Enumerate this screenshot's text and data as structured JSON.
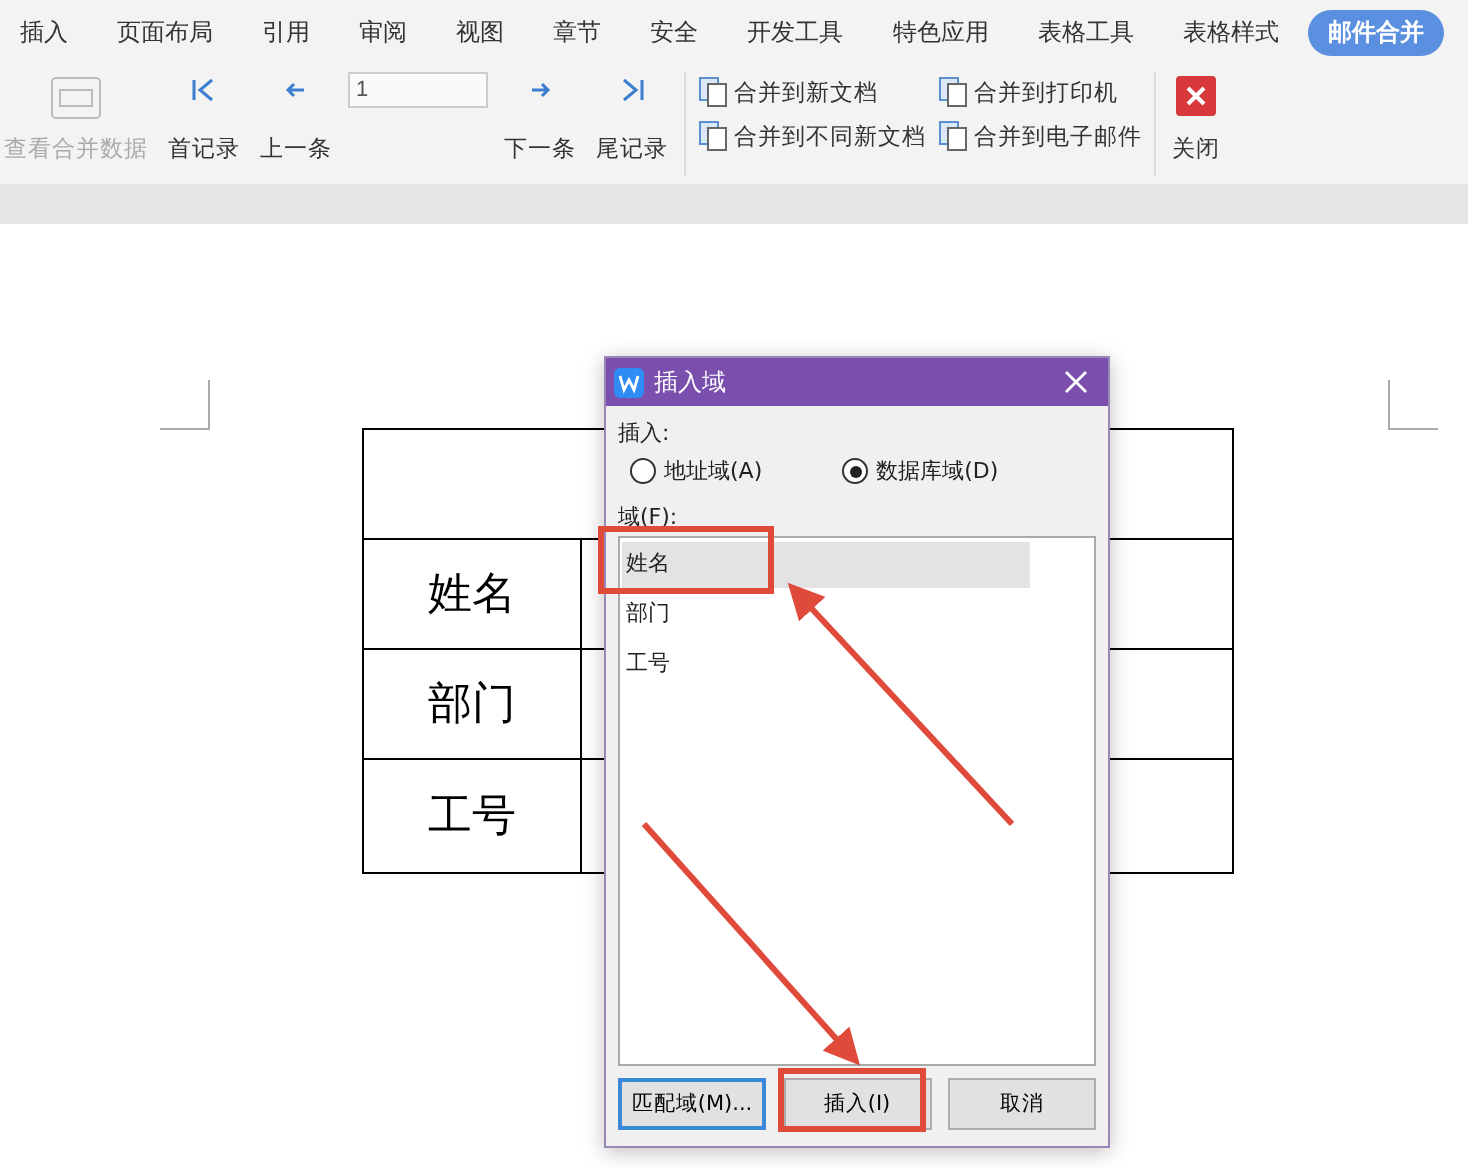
{
  "tabs": [
    {
      "label": "插入",
      "selected": false
    },
    {
      "label": "页面布局",
      "selected": false
    },
    {
      "label": "引用",
      "selected": false
    },
    {
      "label": "审阅",
      "selected": false
    },
    {
      "label": "视图",
      "selected": false
    },
    {
      "label": "章节",
      "selected": false
    },
    {
      "label": "安全",
      "selected": false
    },
    {
      "label": "开发工具",
      "selected": false
    },
    {
      "label": "特色应用",
      "selected": false
    },
    {
      "label": "表格工具",
      "selected": false
    },
    {
      "label": "表格样式",
      "selected": false
    },
    {
      "label": "邮件合并",
      "selected": true
    }
  ],
  "ribbon": {
    "view_data": {
      "label": "查看合并数据",
      "disabled": true
    },
    "first": "首记录",
    "prev": "上一条",
    "record": "1",
    "next": "下一条",
    "last": "尾记录",
    "merge": [
      "合并到新文档",
      "合并到打印机",
      "合并到不同新文档",
      "合并到电子邮件"
    ],
    "close": "关闭"
  },
  "table": {
    "labels": [
      "姓名",
      "部门",
      "工号"
    ]
  },
  "dialog": {
    "title": "插入域",
    "insert_label": "插入:",
    "options": [
      {
        "label": "地址域(A)",
        "selected": false
      },
      {
        "label": "数据库域(D)",
        "selected": true
      }
    ],
    "fields_label": "域(F):",
    "fields": [
      {
        "label": "姓名",
        "selected": true
      },
      {
        "label": "部门",
        "selected": false
      },
      {
        "label": "工号",
        "selected": false
      }
    ],
    "buttons": [
      "匹配域(M)...",
      "插入(I)",
      "取消"
    ]
  }
}
